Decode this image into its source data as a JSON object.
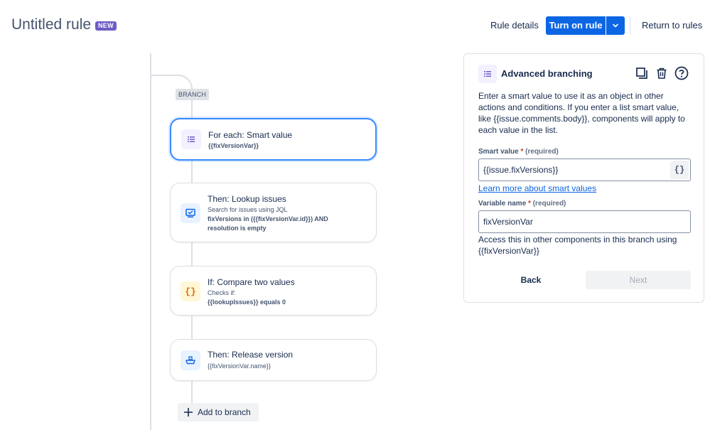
{
  "header": {
    "title": "Untitled rule",
    "badge": "NEW",
    "rule_details": "Rule details",
    "turn_on": "Turn on rule",
    "return_to_rules": "Return to rules"
  },
  "flow": {
    "branch_tag": "BRANCH",
    "cards": [
      {
        "title": "For each: Smart value",
        "bold": "{{fixVersionVar}}",
        "icon": "list-icon",
        "selected": true
      },
      {
        "title": "Then: Lookup issues",
        "subtitle": "Search for issues using JQL",
        "bold": "fixVersions in ({{fixVersionVar.id}}) AND resolution is empty",
        "icon": "monitor-icon"
      },
      {
        "title": "If: Compare two values",
        "subtitle": "Checks if:",
        "bold": "{{lookupIssues}} equals 0",
        "icon": "braces-icon"
      },
      {
        "title": "Then: Release version",
        "subtitle": "{{fixVersionVar.name}}",
        "icon": "ship-icon"
      }
    ],
    "add_to_branch": "Add to branch"
  },
  "panel": {
    "title": "Advanced branching",
    "description": "Enter a smart value to use it as an object in other actions and conditions. If you enter a list smart value, like {{issue.comments.body}}, components will apply to each value in the list.",
    "smart_value_label": "Smart value",
    "smart_value_required": "(required)",
    "smart_value": "{{issue.fixVersions}}",
    "smart_button": "{}",
    "learn_more": "Learn more about smart values",
    "variable_label": "Variable name",
    "variable_required": "(required)",
    "variable_value": "fixVersionVar",
    "access_text": "Access this in other components in this branch using {{fixVersionVar}}",
    "back": "Back",
    "next": "Next"
  },
  "colors": {
    "primary": "#0c66e4",
    "badge": "#6e5dc6",
    "selected_border": "#388bff"
  }
}
